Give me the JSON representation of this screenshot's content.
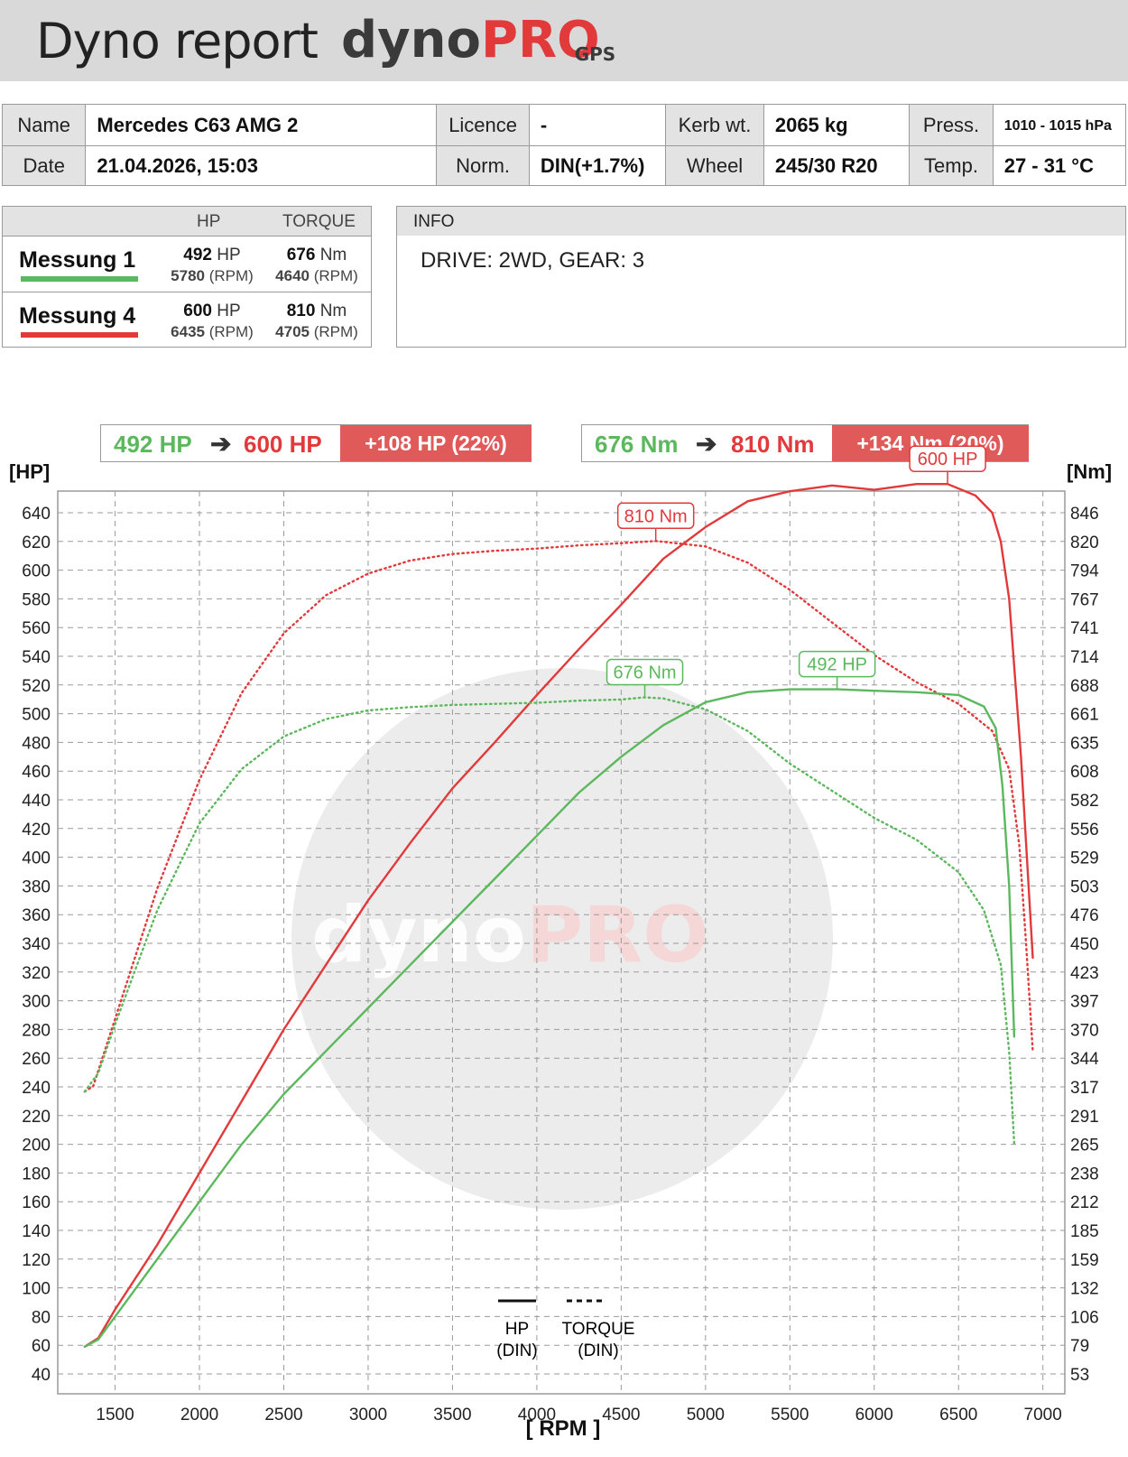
{
  "header": {
    "title": "Dyno report",
    "logo_main": "dyno",
    "logo_accent": "PRO",
    "logo_sub": "GPS"
  },
  "info_table": {
    "name_label": "Name",
    "name_value": "Mercedes C63 AMG 2",
    "licence_label": "Licence",
    "licence_value": "-",
    "kerb_label": "Kerb wt.",
    "kerb_value": "2065 kg",
    "press_label": "Press.",
    "press_value": "1010 - 1015 hPa",
    "date_label": "Date",
    "date_value": "21.04.2026, 15:03",
    "norm_label": "Norm.",
    "norm_value": "DIN(+1.7%)",
    "wheel_label": "Wheel",
    "wheel_value": "245/30 R20",
    "temp_label": "Temp.",
    "temp_value": "27 - 31 °C"
  },
  "summary": {
    "hp_header": "HP",
    "torque_header": "TORQUE",
    "runs": [
      {
        "name": "Messung 1",
        "color": "#5cb85c",
        "hp": "492",
        "hp_unit": "HP",
        "hp_rpm": "5780",
        "torque": "676",
        "torque_unit": "Nm",
        "torque_rpm": "4640",
        "rpm_unit": "(RPM)"
      },
      {
        "name": "Messung 4",
        "color": "#e2393b",
        "hp": "600",
        "hp_unit": "HP",
        "hp_rpm": "6435",
        "torque": "810",
        "torque_unit": "Nm",
        "torque_rpm": "4705",
        "rpm_unit": "(RPM)"
      }
    ]
  },
  "info_box": {
    "header": "INFO",
    "text": "DRIVE: 2WD,  GEAR: 3"
  },
  "comparison": {
    "hp_before": "492 HP",
    "hp_after": "600 HP",
    "hp_delta": "+108 HP  (22%)",
    "nm_before": "676 Nm",
    "nm_after": "810 Nm",
    "nm_delta": "+134 Nm  (20%)",
    "arrow": "➔"
  },
  "chart_data": {
    "type": "line",
    "xlabel": "[ RPM ]",
    "ylabel_left": "[HP]",
    "ylabel_right": "[Nm]",
    "xlim": [
      1160,
      7130
    ],
    "ylim_left": [
      40,
      640
    ],
    "x_ticks": [
      1500,
      2000,
      2500,
      3000,
      3500,
      4000,
      4500,
      5000,
      5500,
      6000,
      6500,
      7000
    ],
    "y_ticks_left": [
      40,
      60,
      80,
      100,
      120,
      140,
      160,
      180,
      200,
      220,
      240,
      260,
      280,
      300,
      320,
      340,
      360,
      380,
      400,
      420,
      440,
      460,
      480,
      500,
      520,
      540,
      560,
      580,
      600,
      620,
      640
    ],
    "y_ticks_right": [
      "53",
      "79",
      "106",
      "132",
      "159",
      "185",
      "212",
      "238",
      "265",
      "291",
      "317",
      "344",
      "370",
      "397",
      "423",
      "450",
      "476",
      "503",
      "529",
      "556",
      "582",
      "608",
      "635",
      "661",
      "688",
      "714",
      "741",
      "767",
      "794",
      "820",
      "846"
    ],
    "grid": true,
    "legend_position": "bottom-center",
    "legend": {
      "hp_label": "HP",
      "hp_sub": "(DIN)",
      "torque_label": "TORQUE",
      "torque_sub": "(DIN)"
    },
    "colors": {
      "run1": "#5cb85c",
      "run2": "#e2393b"
    },
    "series": [
      {
        "name": "Messung 4",
        "kind": "HP (DIN)",
        "color": "#e2393b",
        "style": "solid",
        "x": [
          1320,
          1400,
          1500,
          1750,
          2000,
          2250,
          2500,
          2750,
          3000,
          3250,
          3500,
          3750,
          4000,
          4250,
          4500,
          4750,
          5000,
          5250,
          5500,
          5750,
          6000,
          6250,
          6435,
          6600,
          6700,
          6750,
          6800,
          6870,
          6940
        ],
        "y": [
          59,
          65,
          85,
          130,
          180,
          230,
          280,
          325,
          370,
          410,
          448,
          480,
          513,
          545,
          576,
          608,
          630,
          648,
          655,
          659,
          656,
          660,
          660,
          652,
          640,
          620,
          580,
          470,
          330
        ]
      },
      {
        "name": "Messung 4",
        "kind": "TORQUE (DIN)",
        "color": "#e2393b",
        "style": "dotted",
        "x": [
          1320,
          1370,
          1500,
          1750,
          2000,
          2250,
          2500,
          2750,
          3000,
          3250,
          3500,
          3750,
          4000,
          4250,
          4500,
          4705,
          5000,
          5250,
          5500,
          5750,
          6000,
          6250,
          6500,
          6700,
          6800,
          6860,
          6900,
          6940
        ],
        "y": [
          313,
          318,
          380,
          500,
          600,
          680,
          735,
          770,
          790,
          802,
          808,
          811,
          813,
          816,
          818,
          820,
          815,
          800,
          775,
          745,
          715,
          690,
          670,
          645,
          610,
          540,
          450,
          350
        ]
      },
      {
        "name": "Messung 1",
        "kind": "HP (DIN)",
        "color": "#5cb85c",
        "style": "solid",
        "x": [
          1320,
          1400,
          1500,
          1750,
          2000,
          2250,
          2500,
          2750,
          3000,
          3250,
          3500,
          3750,
          4000,
          4250,
          4500,
          4750,
          5000,
          5250,
          5500,
          5780,
          6000,
          6250,
          6500,
          6650,
          6720,
          6760,
          6800,
          6830
        ],
        "y": [
          59,
          64,
          80,
          120,
          160,
          200,
          235,
          265,
          295,
          325,
          355,
          385,
          415,
          445,
          470,
          492,
          508,
          515,
          517,
          517,
          516,
          515,
          513,
          505,
          490,
          450,
          380,
          275
        ]
      },
      {
        "name": "Messung 1",
        "kind": "TORQUE (DIN)",
        "color": "#5cb85c",
        "style": "dotted",
        "x": [
          1320,
          1400,
          1500,
          1750,
          2000,
          2250,
          2500,
          2750,
          3000,
          3250,
          3500,
          3750,
          4000,
          4250,
          4500,
          4640,
          4750,
          5000,
          5250,
          5500,
          5750,
          6000,
          6250,
          6500,
          6650,
          6750,
          6800,
          6830
        ],
        "y": [
          313,
          330,
          375,
          480,
          560,
          610,
          640,
          656,
          664,
          667,
          669,
          670,
          671,
          673,
          674,
          676,
          675,
          665,
          645,
          615,
          590,
          565,
          545,
          515,
          480,
          430,
          350,
          265
        ]
      }
    ],
    "annotations": [
      {
        "text": "810 Nm",
        "color": "#e2393b",
        "x": 4705
      },
      {
        "text": "600 HP",
        "color": "#e2393b",
        "x": 6435
      },
      {
        "text": "676 Nm",
        "color": "#5cb85c",
        "x": 4640
      },
      {
        "text": "492 HP",
        "color": "#5cb85c",
        "x": 5780
      }
    ]
  }
}
